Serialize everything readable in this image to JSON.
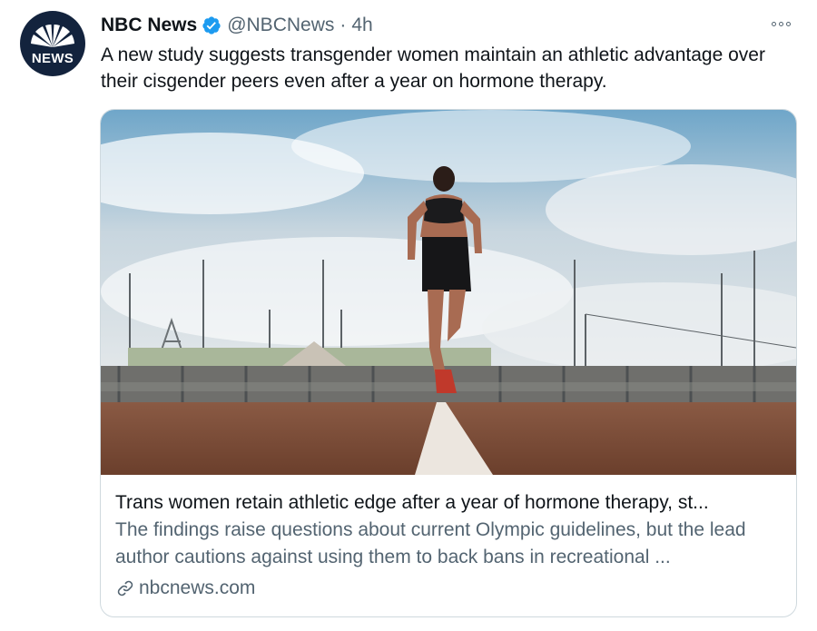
{
  "tweet": {
    "author_name": "NBC News",
    "handle": "@NBCNews",
    "separator": "·",
    "time": "4h",
    "avatar_label": "NEWS",
    "text": "A new study suggests transgender women maintain an athletic advantage over their cisgender peers even after a year on hormone therapy."
  },
  "card": {
    "title": "Trans women retain athletic edge after a year of hormone therapy, st...",
    "description": "The findings raise questions about current Olympic guidelines, but the lead author cautions against using them to back bans in recreational ...",
    "domain": "nbcnews.com",
    "image_icon": "photo-of-runner-on-track"
  },
  "icons": {
    "verified": "verified-badge-icon",
    "more": "more-options-icon",
    "link": "link-icon"
  },
  "colors": {
    "verified": "#1d9bf0",
    "secondary_text": "#536471",
    "primary_text": "#0f1419",
    "card_border": "#cfd9de",
    "avatar_bg": "#13233d"
  }
}
